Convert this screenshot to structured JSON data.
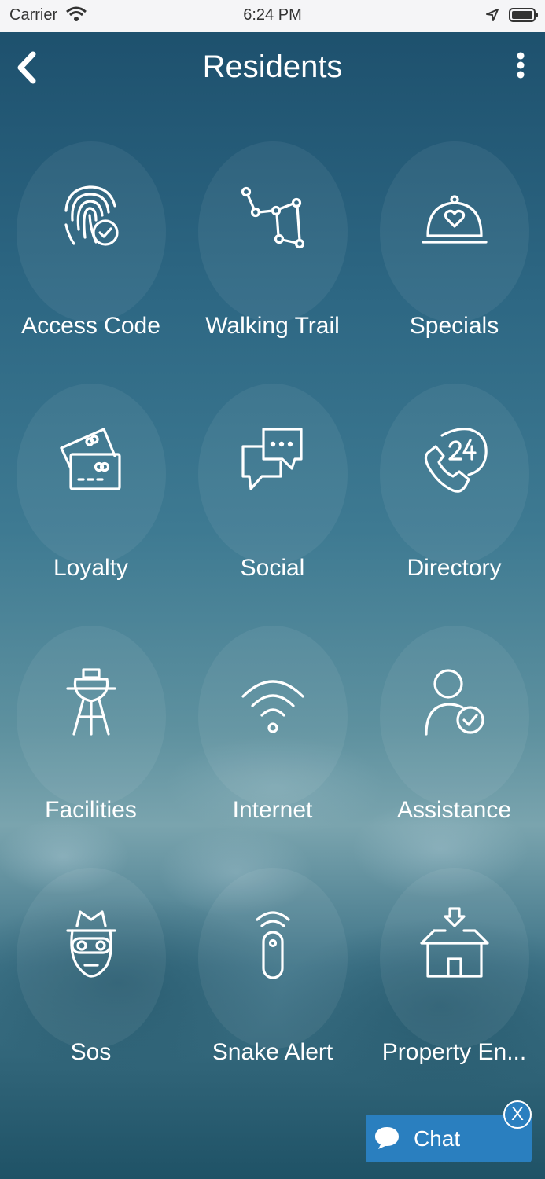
{
  "status_bar": {
    "carrier": "Carrier",
    "time": "6:24 PM"
  },
  "header": {
    "title": "Residents",
    "back_icon": "chevron-left-icon",
    "more_icon": "more-vertical-icon"
  },
  "tiles": [
    {
      "label": "Access Code",
      "icon": "fingerprint-check-icon"
    },
    {
      "label": "Walking Trail",
      "icon": "trail-map-icon"
    },
    {
      "label": "Specials",
      "icon": "cloche-heart-icon"
    },
    {
      "label": "Loyalty",
      "icon": "loyalty-cards-icon"
    },
    {
      "label": "Social",
      "icon": "chat-bubbles-icon"
    },
    {
      "label": "Directory",
      "icon": "phone-24-icon"
    },
    {
      "label": "Facilities",
      "icon": "bbq-grill-icon"
    },
    {
      "label": "Internet",
      "icon": "wifi-icon"
    },
    {
      "label": "Assistance",
      "icon": "user-check-icon"
    },
    {
      "label": "Sos",
      "icon": "masked-face-icon"
    },
    {
      "label": "Snake Alert",
      "icon": "remote-signal-icon"
    },
    {
      "label": "Property En...",
      "icon": "house-arrow-icon"
    }
  ],
  "chat": {
    "label": "Chat",
    "close_label": "X"
  },
  "colors": {
    "status_bar_bg": "#f5f5f7",
    "chat_bg": "#2a7fbf",
    "text": "#ffffff"
  }
}
